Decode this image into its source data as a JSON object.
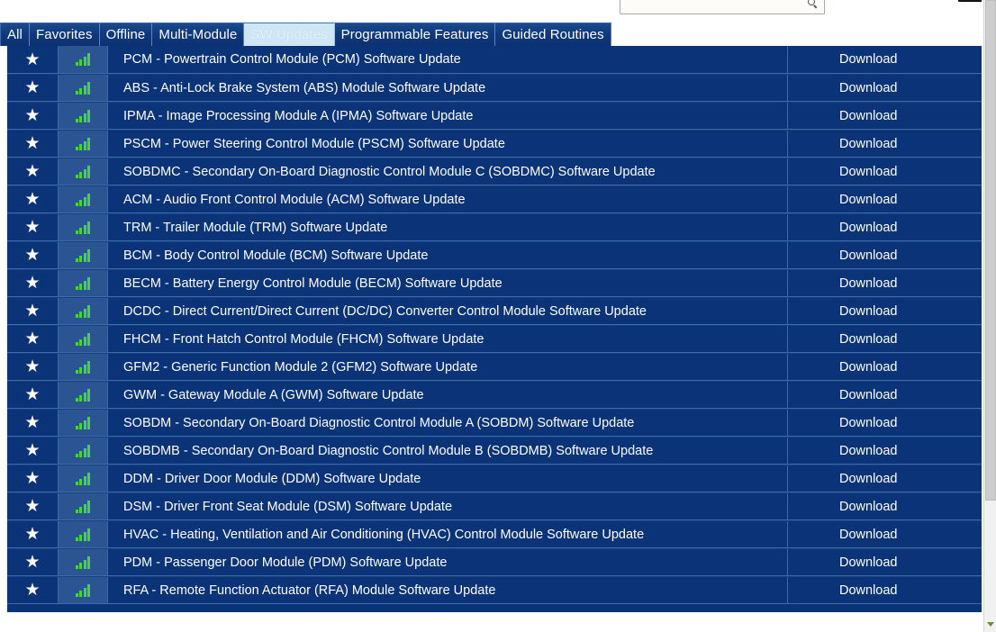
{
  "top": {
    "search": {
      "value": "",
      "placeholder": "",
      "icon": "search-icon"
    },
    "keyboard_icon": "keyboard-icon"
  },
  "tabs": [
    {
      "label": "All",
      "active": false
    },
    {
      "label": "Favorites",
      "active": false
    },
    {
      "label": "Offline",
      "active": false
    },
    {
      "label": "Multi-Module",
      "active": false
    },
    {
      "label": "SW Updates",
      "active": true
    },
    {
      "label": "Programmable Features",
      "active": false
    },
    {
      "label": "Guided Routines",
      "active": false
    }
  ],
  "table": {
    "action_label": "Download",
    "star_icon": "star-icon",
    "signal_icon": "signal-bars-icon",
    "rows": [
      {
        "name": "PCM - Powertrain Control Module (PCM) Software Update"
      },
      {
        "name": "ABS - Anti-Lock Brake System (ABS) Module Software Update"
      },
      {
        "name": "IPMA - Image Processing Module A (IPMA) Software Update"
      },
      {
        "name": "PSCM - Power Steering Control Module (PSCM) Software Update"
      },
      {
        "name": "SOBDMC - Secondary On-Board Diagnostic Control Module C (SOBDMC) Software Update"
      },
      {
        "name": "ACM - Audio Front Control Module (ACM) Software Update"
      },
      {
        "name": "TRM - Trailer Module (TRM) Software Update"
      },
      {
        "name": "BCM - Body Control Module (BCM) Software Update"
      },
      {
        "name": "BECM - Battery Energy Control Module (BECM) Software Update"
      },
      {
        "name": "DCDC - Direct Current/Direct Current (DC/DC) Converter Control Module Software Update"
      },
      {
        "name": "FHCM - Front Hatch Control Module (FHCM) Software Update"
      },
      {
        "name": "GFM2 - Generic Function Module 2 (GFM2) Software Update"
      },
      {
        "name": "GWM - Gateway Module A (GWM) Software Update"
      },
      {
        "name": "SOBDM - Secondary On-Board Diagnostic Control Module A (SOBDM) Software Update"
      },
      {
        "name": "SOBDMB - Secondary On-Board Diagnostic Control Module B (SOBDMB) Software Update"
      },
      {
        "name": "DDM - Driver Door Module (DDM) Software Update"
      },
      {
        "name": "DSM - Driver Front Seat Module (DSM) Software Update"
      },
      {
        "name": "HVAC - Heating, Ventilation and Air Conditioning (HVAC) Control Module Software Update"
      },
      {
        "name": "PDM - Passenger Door Module (PDM) Software Update"
      },
      {
        "name": "RFA - Remote Function Actuator (RFA) Module Software Update"
      }
    ]
  },
  "colors": {
    "row_bg": "#0b3478",
    "row_divider": "#3b6aad",
    "signal_cell_bg": "#2b5493",
    "signal_green": "#46d63c",
    "tab_bg": "#103a7c",
    "tab_active_bg": "#cfe7f5",
    "text": "#ffffff"
  }
}
